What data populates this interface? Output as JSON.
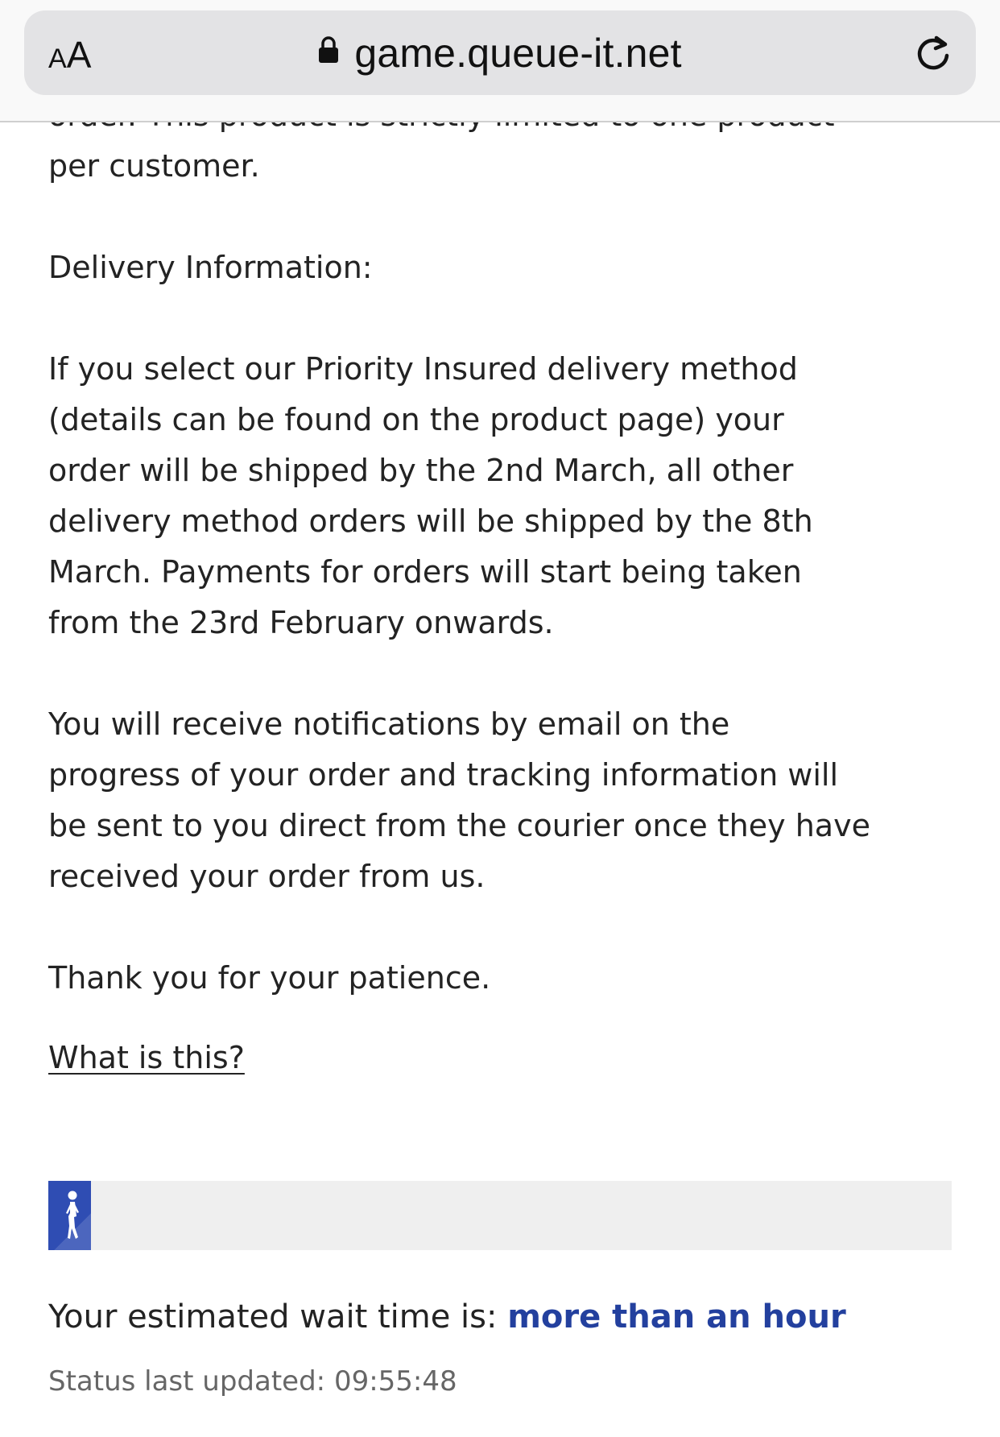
{
  "browser": {
    "text_size_button": {
      "small": "A",
      "large": "A"
    },
    "url": "game.queue-it.net",
    "lock_icon": "lock-icon",
    "reload_icon": "reload-icon"
  },
  "content": {
    "paragraph_top": "order. This product is strictly limited to one product\nper customer.",
    "delivery_heading": "Delivery Information:",
    "delivery_paragraph": "If you select our Priority Insured delivery method\n(details can be found on the product page) your\norder will be shipped by the 2nd March, all other\ndelivery method orders will be shipped by the 8th\nMarch. Payments for orders will start being taken\nfrom the 23rd February onwards.",
    "notify_paragraph": "You will receive notifications by email on the\nprogress of your order and tracking information will\nbe sent to you direct from the courier once they have\nreceived your order from us.",
    "thanks": "Thank you for your patience.",
    "what_is_this_link": "What is this?"
  },
  "queue": {
    "progress_fraction": 0.047,
    "progress_color": "#2f4db3",
    "track_color": "#efefef",
    "walker_icon": "walking-person-icon",
    "wait_label": "Your estimated wait time is:",
    "wait_value": "more than an hour",
    "wait_value_color": "#23409e",
    "status_label": "Status last updated:",
    "status_time": "09:55:48"
  }
}
